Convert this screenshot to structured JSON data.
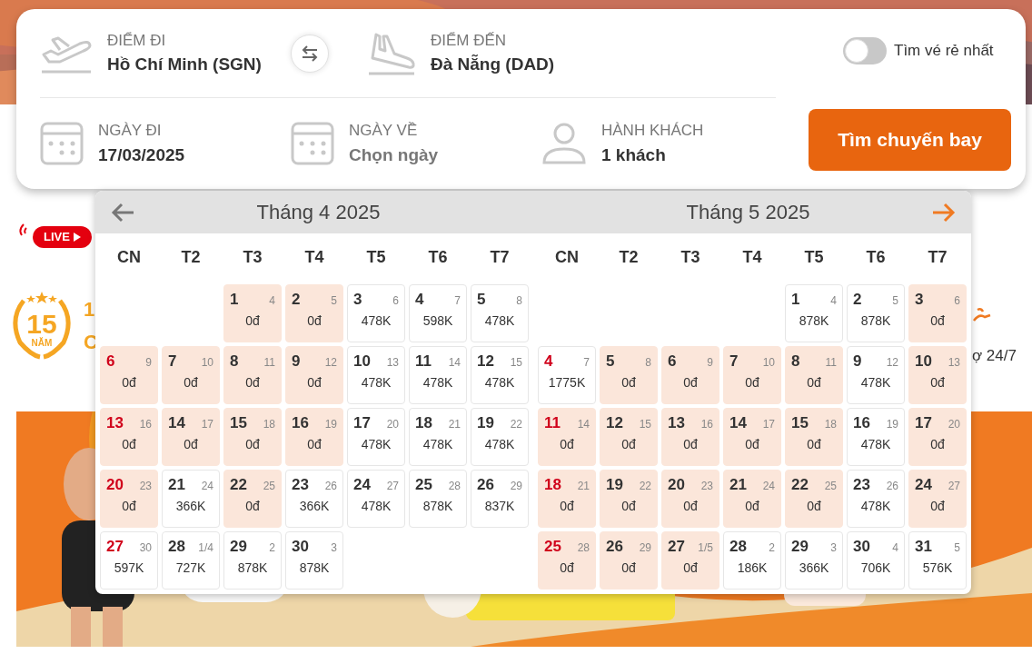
{
  "search": {
    "origin": {
      "label": "ĐIỂM ĐI",
      "value": "Hồ Chí Minh (SGN)"
    },
    "destination": {
      "label": "ĐIỂM ĐẾN",
      "value": "Đà Nẵng (DAD)"
    },
    "cheapest_toggle": {
      "label": "Tìm vé rẻ nhất",
      "on": false
    },
    "depart_date": {
      "label": "NGÀY ĐI",
      "value": "17/03/2025"
    },
    "return_date": {
      "label": "NGÀY VỀ",
      "placeholder": "Chọn ngày"
    },
    "passengers": {
      "label": "HÀNH KHÁCH",
      "value": "1 khách"
    },
    "search_button": "Tìm chuyến bay"
  },
  "background": {
    "live_badge": "LIVE",
    "anniversary_badge": {
      "number": "15",
      "label": "NĂM"
    },
    "promo_fragments": [
      "1",
      "C"
    ],
    "support_fragment": "ợ 24/7"
  },
  "calendar": {
    "months": [
      {
        "title": "Tháng 4 2025",
        "weekdays": [
          "CN",
          "T2",
          "T3",
          "T4",
          "T5",
          "T6",
          "T7"
        ],
        "cells": [
          {
            "kind": "blank"
          },
          {
            "kind": "blank"
          },
          {
            "kind": "day",
            "day": "1",
            "lunar": "4",
            "price": "0đ",
            "highlighted": true
          },
          {
            "kind": "day",
            "day": "2",
            "lunar": "5",
            "price": "0đ",
            "highlighted": true
          },
          {
            "kind": "day",
            "day": "3",
            "lunar": "6",
            "price": "478K",
            "highlighted": false
          },
          {
            "kind": "day",
            "day": "4",
            "lunar": "7",
            "price": "598K",
            "highlighted": false
          },
          {
            "kind": "day",
            "day": "5",
            "lunar": "8",
            "price": "478K",
            "highlighted": false
          },
          {
            "kind": "day",
            "day": "6",
            "lunar": "9",
            "price": "0đ",
            "highlighted": true
          },
          {
            "kind": "day",
            "day": "7",
            "lunar": "10",
            "price": "0đ",
            "highlighted": true
          },
          {
            "kind": "day",
            "day": "8",
            "lunar": "11",
            "price": "0đ",
            "highlighted": true
          },
          {
            "kind": "day",
            "day": "9",
            "lunar": "12",
            "price": "0đ",
            "highlighted": true
          },
          {
            "kind": "day",
            "day": "10",
            "lunar": "13",
            "price": "478K",
            "highlighted": false
          },
          {
            "kind": "day",
            "day": "11",
            "lunar": "14",
            "price": "478K",
            "highlighted": false
          },
          {
            "kind": "day",
            "day": "12",
            "lunar": "15",
            "price": "478K",
            "highlighted": false
          },
          {
            "kind": "day",
            "day": "13",
            "lunar": "16",
            "price": "0đ",
            "highlighted": true
          },
          {
            "kind": "day",
            "day": "14",
            "lunar": "17",
            "price": "0đ",
            "highlighted": true
          },
          {
            "kind": "day",
            "day": "15",
            "lunar": "18",
            "price": "0đ",
            "highlighted": true
          },
          {
            "kind": "day",
            "day": "16",
            "lunar": "19",
            "price": "0đ",
            "highlighted": true
          },
          {
            "kind": "day",
            "day": "17",
            "lunar": "20",
            "price": "478K",
            "highlighted": false
          },
          {
            "kind": "day",
            "day": "18",
            "lunar": "21",
            "price": "478K",
            "highlighted": false
          },
          {
            "kind": "day",
            "day": "19",
            "lunar": "22",
            "price": "478K",
            "highlighted": false
          },
          {
            "kind": "day",
            "day": "20",
            "lunar": "23",
            "price": "0đ",
            "highlighted": true
          },
          {
            "kind": "day",
            "day": "21",
            "lunar": "24",
            "price": "366K",
            "highlighted": false
          },
          {
            "kind": "day",
            "day": "22",
            "lunar": "25",
            "price": "0đ",
            "highlighted": true
          },
          {
            "kind": "day",
            "day": "23",
            "lunar": "26",
            "price": "366K",
            "highlighted": false
          },
          {
            "kind": "day",
            "day": "24",
            "lunar": "27",
            "price": "478K",
            "highlighted": false
          },
          {
            "kind": "day",
            "day": "25",
            "lunar": "28",
            "price": "878K",
            "highlighted": false
          },
          {
            "kind": "day",
            "day": "26",
            "lunar": "29",
            "price": "837K",
            "highlighted": false
          },
          {
            "kind": "day",
            "day": "27",
            "lunar": "30",
            "price": "597K",
            "highlighted": false
          },
          {
            "kind": "day",
            "day": "28",
            "lunar": "1/4",
            "price": "727K",
            "highlighted": false
          },
          {
            "kind": "day",
            "day": "29",
            "lunar": "2",
            "price": "878K",
            "highlighted": false
          },
          {
            "kind": "day",
            "day": "30",
            "lunar": "3",
            "price": "878K",
            "highlighted": false
          }
        ]
      },
      {
        "title": "Tháng 5 2025",
        "weekdays": [
          "CN",
          "T2",
          "T3",
          "T4",
          "T5",
          "T6",
          "T7"
        ],
        "cells": [
          {
            "kind": "blank"
          },
          {
            "kind": "blank"
          },
          {
            "kind": "blank"
          },
          {
            "kind": "blank"
          },
          {
            "kind": "day",
            "day": "1",
            "lunar": "4",
            "price": "878K",
            "highlighted": false
          },
          {
            "kind": "day",
            "day": "2",
            "lunar": "5",
            "price": "878K",
            "highlighted": false
          },
          {
            "kind": "day",
            "day": "3",
            "lunar": "6",
            "price": "0đ",
            "highlighted": true
          },
          {
            "kind": "day",
            "day": "4",
            "lunar": "7",
            "price": "1775K",
            "highlighted": false
          },
          {
            "kind": "day",
            "day": "5",
            "lunar": "8",
            "price": "0đ",
            "highlighted": true
          },
          {
            "kind": "day",
            "day": "6",
            "lunar": "9",
            "price": "0đ",
            "highlighted": true
          },
          {
            "kind": "day",
            "day": "7",
            "lunar": "10",
            "price": "0đ",
            "highlighted": true
          },
          {
            "kind": "day",
            "day": "8",
            "lunar": "11",
            "price": "0đ",
            "highlighted": true
          },
          {
            "kind": "day",
            "day": "9",
            "lunar": "12",
            "price": "478K",
            "highlighted": false
          },
          {
            "kind": "day",
            "day": "10",
            "lunar": "13",
            "price": "0đ",
            "highlighted": true
          },
          {
            "kind": "day",
            "day": "11",
            "lunar": "14",
            "price": "0đ",
            "highlighted": true
          },
          {
            "kind": "day",
            "day": "12",
            "lunar": "15",
            "price": "0đ",
            "highlighted": true
          },
          {
            "kind": "day",
            "day": "13",
            "lunar": "16",
            "price": "0đ",
            "highlighted": true
          },
          {
            "kind": "day",
            "day": "14",
            "lunar": "17",
            "price": "0đ",
            "highlighted": true
          },
          {
            "kind": "day",
            "day": "15",
            "lunar": "18",
            "price": "0đ",
            "highlighted": true
          },
          {
            "kind": "day",
            "day": "16",
            "lunar": "19",
            "price": "478K",
            "highlighted": false
          },
          {
            "kind": "day",
            "day": "17",
            "lunar": "20",
            "price": "0đ",
            "highlighted": true
          },
          {
            "kind": "day",
            "day": "18",
            "lunar": "21",
            "price": "0đ",
            "highlighted": true
          },
          {
            "kind": "day",
            "day": "19",
            "lunar": "22",
            "price": "0đ",
            "highlighted": true
          },
          {
            "kind": "day",
            "day": "20",
            "lunar": "23",
            "price": "0đ",
            "highlighted": true
          },
          {
            "kind": "day",
            "day": "21",
            "lunar": "24",
            "price": "0đ",
            "highlighted": true
          },
          {
            "kind": "day",
            "day": "22",
            "lunar": "25",
            "price": "0đ",
            "highlighted": true
          },
          {
            "kind": "day",
            "day": "23",
            "lunar": "26",
            "price": "478K",
            "highlighted": false
          },
          {
            "kind": "day",
            "day": "24",
            "lunar": "27",
            "price": "0đ",
            "highlighted": true
          },
          {
            "kind": "day",
            "day": "25",
            "lunar": "28",
            "price": "0đ",
            "highlighted": true
          },
          {
            "kind": "day",
            "day": "26",
            "lunar": "29",
            "price": "0đ",
            "highlighted": true
          },
          {
            "kind": "day",
            "day": "27",
            "lunar": "1/5",
            "price": "0đ",
            "highlighted": true
          },
          {
            "kind": "day",
            "day": "28",
            "lunar": "2",
            "price": "186K",
            "highlighted": false
          },
          {
            "kind": "day",
            "day": "29",
            "lunar": "3",
            "price": "366K",
            "highlighted": false
          },
          {
            "kind": "day",
            "day": "30",
            "lunar": "4",
            "price": "706K",
            "highlighted": false
          },
          {
            "kind": "day",
            "day": "31",
            "lunar": "5",
            "price": "576K",
            "highlighted": false
          }
        ]
      }
    ]
  }
}
